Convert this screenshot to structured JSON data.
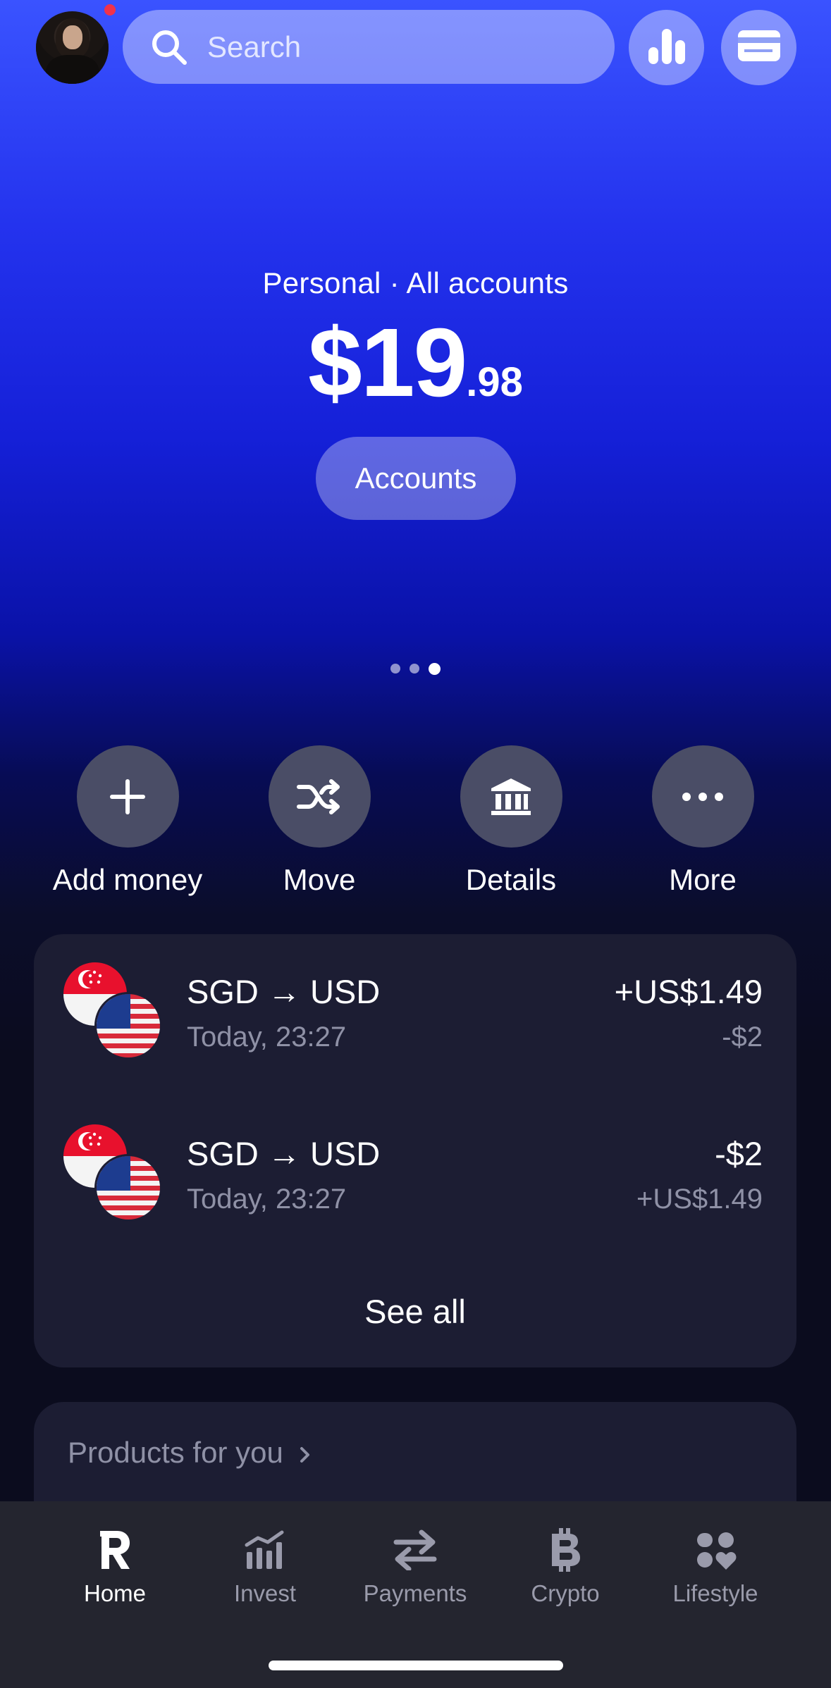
{
  "header": {
    "search_placeholder": "Search",
    "has_notification": true
  },
  "balance": {
    "account_label": "Personal · All accounts",
    "whole": "$19",
    "cents": ".98",
    "accounts_button": "Accounts",
    "page_indicator": {
      "count": 3,
      "active": 3
    }
  },
  "actions": [
    {
      "label": "Add money",
      "icon": "plus-icon"
    },
    {
      "label": "Move",
      "icon": "shuffle-icon"
    },
    {
      "label": "Details",
      "icon": "bank-icon"
    },
    {
      "label": "More",
      "icon": "more-dots-icon"
    }
  ],
  "transactions": [
    {
      "title": "SGD → USD",
      "time": "Today, 23:27",
      "primary_amount": "+US$1.49",
      "secondary_amount": "-$2"
    },
    {
      "title": "SGD → USD",
      "time": "Today, 23:27",
      "primary_amount": "-$2",
      "secondary_amount": "+US$1.49"
    }
  ],
  "see_all": "See all",
  "products": {
    "heading": "Products for you"
  },
  "tabs": [
    {
      "label": "Home",
      "icon": "revolut-r-icon",
      "active": true
    },
    {
      "label": "Invest",
      "icon": "invest-chart-icon",
      "active": false
    },
    {
      "label": "Payments",
      "icon": "transfer-arrows-icon",
      "active": false
    },
    {
      "label": "Crypto",
      "icon": "bitcoin-icon",
      "active": false
    },
    {
      "label": "Lifestyle",
      "icon": "lifestyle-icon",
      "active": false
    }
  ],
  "colors": {
    "accent_blue": "#2433ee",
    "card_bg": "#1c1d33",
    "muted_text": "#8f91a6",
    "notification": "#f0324a"
  }
}
